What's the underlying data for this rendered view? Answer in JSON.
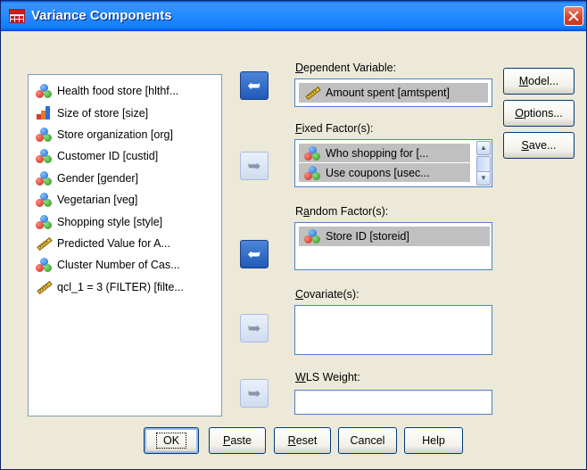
{
  "window": {
    "title": "Variance Components"
  },
  "source_list": {
    "items": [
      {
        "label": "Health food store [hlthf...",
        "icon": "nominal-icon"
      },
      {
        "label": "Size of store [size]",
        "icon": "ordinal-icon"
      },
      {
        "label": "Store organization [org]",
        "icon": "nominal-icon"
      },
      {
        "label": "Customer ID [custid]",
        "icon": "nominal-icon"
      },
      {
        "label": "Gender [gender]",
        "icon": "nominal-icon"
      },
      {
        "label": "Vegetarian [veg]",
        "icon": "nominal-icon"
      },
      {
        "label": "Shopping style [style]",
        "icon": "nominal-icon"
      },
      {
        "label": "Predicted Value for A...",
        "icon": "scale-icon"
      },
      {
        "label": "Cluster Number of Cas...",
        "icon": "nominal-icon"
      },
      {
        "label": "qcl_1 = 3 (FILTER) [filte...",
        "icon": "scale-icon"
      }
    ]
  },
  "fields": {
    "dependent": {
      "label_pre": "",
      "label_u": "D",
      "label_post": "ependent Variable:",
      "items": [
        {
          "label": "Amount spent [amtspent]",
          "icon": "scale-icon"
        }
      ]
    },
    "fixed": {
      "label_pre": "",
      "label_u": "F",
      "label_post": "ixed Factor(s):",
      "items": [
        {
          "label": "Who shopping for [...",
          "icon": "nominal-icon"
        },
        {
          "label": "Use coupons [usec...",
          "icon": "nominal-icon"
        }
      ]
    },
    "random": {
      "label_pre": "R",
      "label_u": "a",
      "label_post": "ndom Factor(s):",
      "items": [
        {
          "label": "Store ID [storeid]",
          "icon": "nominal-icon"
        }
      ]
    },
    "covariate": {
      "label_pre": "",
      "label_u": "C",
      "label_post": "ovariate(s):",
      "items": []
    },
    "wls": {
      "label_pre": "",
      "label_u": "W",
      "label_post": "LS Weight:",
      "items": []
    }
  },
  "side_buttons": {
    "model": {
      "pre": "",
      "u": "M",
      "post": "odel..."
    },
    "options": {
      "pre": "",
      "u": "O",
      "post": "ptions..."
    },
    "save": {
      "pre": "",
      "u": "S",
      "post": "ave..."
    }
  },
  "bottom_buttons": {
    "ok": "OK",
    "paste": {
      "pre": "",
      "u": "P",
      "post": "aste"
    },
    "reset": {
      "pre": "",
      "u": "R",
      "post": "eset"
    },
    "cancel": "Cancel",
    "help": "Help"
  },
  "arrows": {
    "active_glyph": "➥",
    "disabled_glyph": "➥"
  }
}
